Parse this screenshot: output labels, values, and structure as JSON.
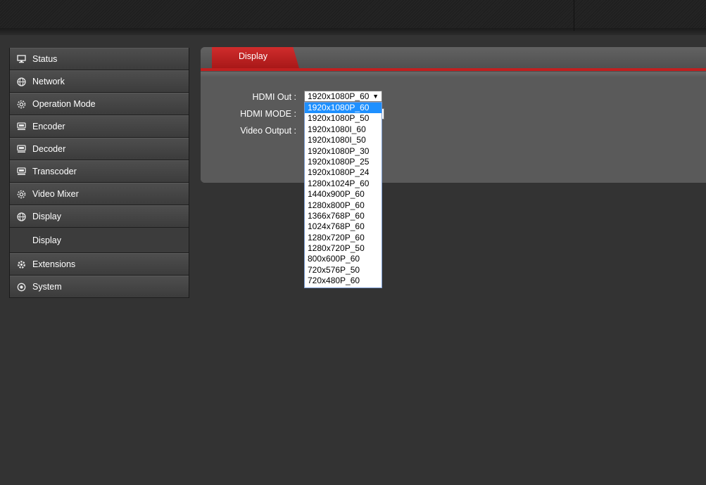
{
  "sidebar": {
    "items": [
      {
        "label": "Status",
        "icon": "monitor-icon"
      },
      {
        "label": "Network",
        "icon": "globe-icon"
      },
      {
        "label": "Operation Mode",
        "icon": "gear-icon"
      },
      {
        "label": "Encoder",
        "icon": "encoder-icon"
      },
      {
        "label": "Decoder",
        "icon": "decoder-icon"
      },
      {
        "label": "Transcoder",
        "icon": "transcoder-icon"
      },
      {
        "label": "Video Mixer",
        "icon": "gear-icon"
      },
      {
        "label": "Display",
        "icon": "globe-icon"
      }
    ],
    "sub_item": {
      "label": "Display"
    },
    "items_after": [
      {
        "label": "Extensions",
        "icon": "cog-icon"
      },
      {
        "label": "System",
        "icon": "target-icon"
      }
    ]
  },
  "panel": {
    "tab_label": "Display",
    "fields": {
      "hdmi_out_label": "HDMI Out :",
      "hdmi_mode_label": "HDMI MODE :",
      "video_output_label": "Video Output :"
    }
  },
  "hdmi_out_select": {
    "selected": "1920x1080P_60",
    "arrow": "▼",
    "options": [
      "1920x1080P_60",
      "1920x1080P_50",
      "1920x1080I_60",
      "1920x1080I_50",
      "1920x1080P_30",
      "1920x1080P_25",
      "1920x1080P_24",
      "1280x1024P_60",
      "1440x900P_60",
      "1280x800P_60",
      "1366x768P_60",
      "1024x768P_60",
      "1280x720P_60",
      "1280x720P_50",
      "800x600P_60",
      "720x576P_50",
      "720x480P_60"
    ],
    "highlighted_index": 0
  },
  "colors": {
    "accent_red": "#c01f1f",
    "highlight_blue": "#1e90ff",
    "background": "#333333"
  }
}
